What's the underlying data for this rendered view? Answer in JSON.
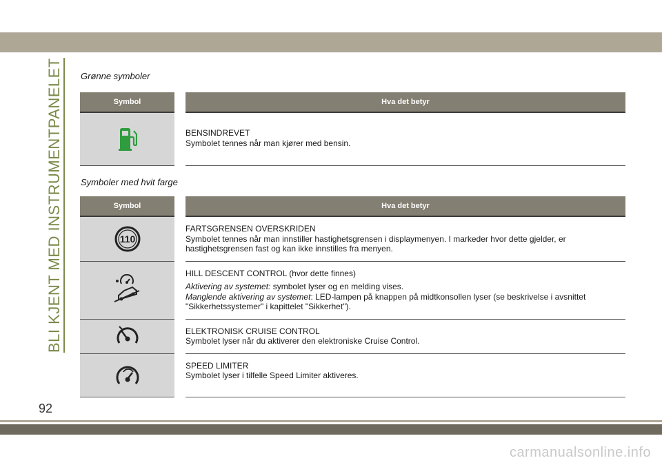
{
  "side_title": "BLI KJENT MED INSTRUMENTPANELET",
  "page_number": "92",
  "watermark": "carmanualsonline.info",
  "green": {
    "heading": "Grønne symboler",
    "col_symbol": "Symbol",
    "col_meaning": "Hva det betyr",
    "rows": [
      {
        "icon": "fuel-pump-icon",
        "title": "BENSINDREVET",
        "text": "Symbolet tennes når man kjører med bensin."
      }
    ]
  },
  "white": {
    "heading": "Symboler med hvit farge",
    "col_symbol": "Symbol",
    "col_meaning": "Hva det betyr",
    "rows": [
      {
        "icon": "speed-limit-110-icon",
        "title": "FARTSGRENSEN OVERSKRIDEN",
        "text": "Symbolet tennes når man innstiller hastighetsgrensen i displaymenyen. I markeder hvor dette gjelder, er hastighetsgrensen fast og kan ikke innstilles fra menyen."
      },
      {
        "icon": "hill-descent-icon",
        "title": "HILL DESCENT CONTROL (hvor dette finnes)",
        "label_a": "Aktivering av systemet:",
        "text_a": " symbolet lyser og en melding vises.",
        "label_b": "Manglende aktivering av systemet",
        "text_b": ": LED-lampen på knappen på midtkonsollen lyser (se beskrivelse i avsnittet \"Sikkerhetssystemer\" i kapittelet \"Sikkerhet\")."
      },
      {
        "icon": "cruise-control-icon",
        "title": "ELEKTRONISK CRUISE CONTROL",
        "text": "Symbolet lyser når du aktiverer den elektroniske Cruise Control."
      },
      {
        "icon": "speed-limiter-icon",
        "title": "SPEED LIMITER",
        "text": "Symbolet lyser i tilfelle Speed Limiter aktiveres."
      }
    ]
  },
  "colors": {
    "header_bg": "#837f72",
    "icon_cell_bg": "#d6d6d6",
    "fuel_icon": "#2e9c3f",
    "band": "#afa796",
    "side_title": "#7b8a4a"
  }
}
